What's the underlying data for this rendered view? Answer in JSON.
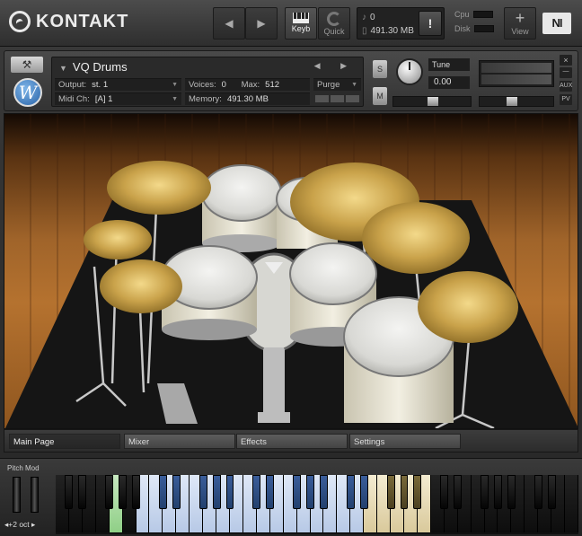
{
  "app": {
    "logo_text": "KONTAKT",
    "ni_logo": "NI"
  },
  "toolbar": {
    "prev_icon": "◀",
    "next_icon": "▶",
    "keyb_label": "Keyb",
    "quick_label": "Quick",
    "midi_activity": "0",
    "memory_total": "491.30 MB",
    "warning_label": "!",
    "cpu_label": "Cpu",
    "disk_label": "Disk",
    "view_label": "View",
    "view_icon": "+"
  },
  "instrument": {
    "name": "VQ Drums",
    "nav_icons": "◀ ▶",
    "output_label": "Output:",
    "output_value": "st. 1",
    "midi_label": "Midi Ch:",
    "midi_value": "[A]  1",
    "voices_label": "Voices:",
    "voices_value": "0",
    "max_label": "Max:",
    "max_value": "512",
    "memory_label": "Memory:",
    "memory_value": "491.30 MB",
    "purge_label": "Purge",
    "solo_label": "S",
    "mute_label": "M",
    "tune_label": "Tune",
    "tune_value": "0.00",
    "close_label": "×",
    "minimize_label": "—",
    "aux_label": "AUX",
    "pv_label": "PV",
    "pan_icon": "L R"
  },
  "tabs": [
    {
      "label": "Main Page",
      "active": true
    },
    {
      "label": "Mixer",
      "active": false
    },
    {
      "label": "Effects",
      "active": false
    },
    {
      "label": "Settings",
      "active": false
    }
  ],
  "keyboard": {
    "pitch_mod_label": "Pitch Mod",
    "octave_label": "◂+2 oct ▸",
    "colors": {
      "blue_zone": "#b7c9e6",
      "cream_zone": "#d9c99b",
      "green_key": "#8fcf86"
    }
  },
  "colors": {
    "accent_blue": "#2a64a8",
    "wood_floor": "#a0642a",
    "rug": "#151515"
  }
}
